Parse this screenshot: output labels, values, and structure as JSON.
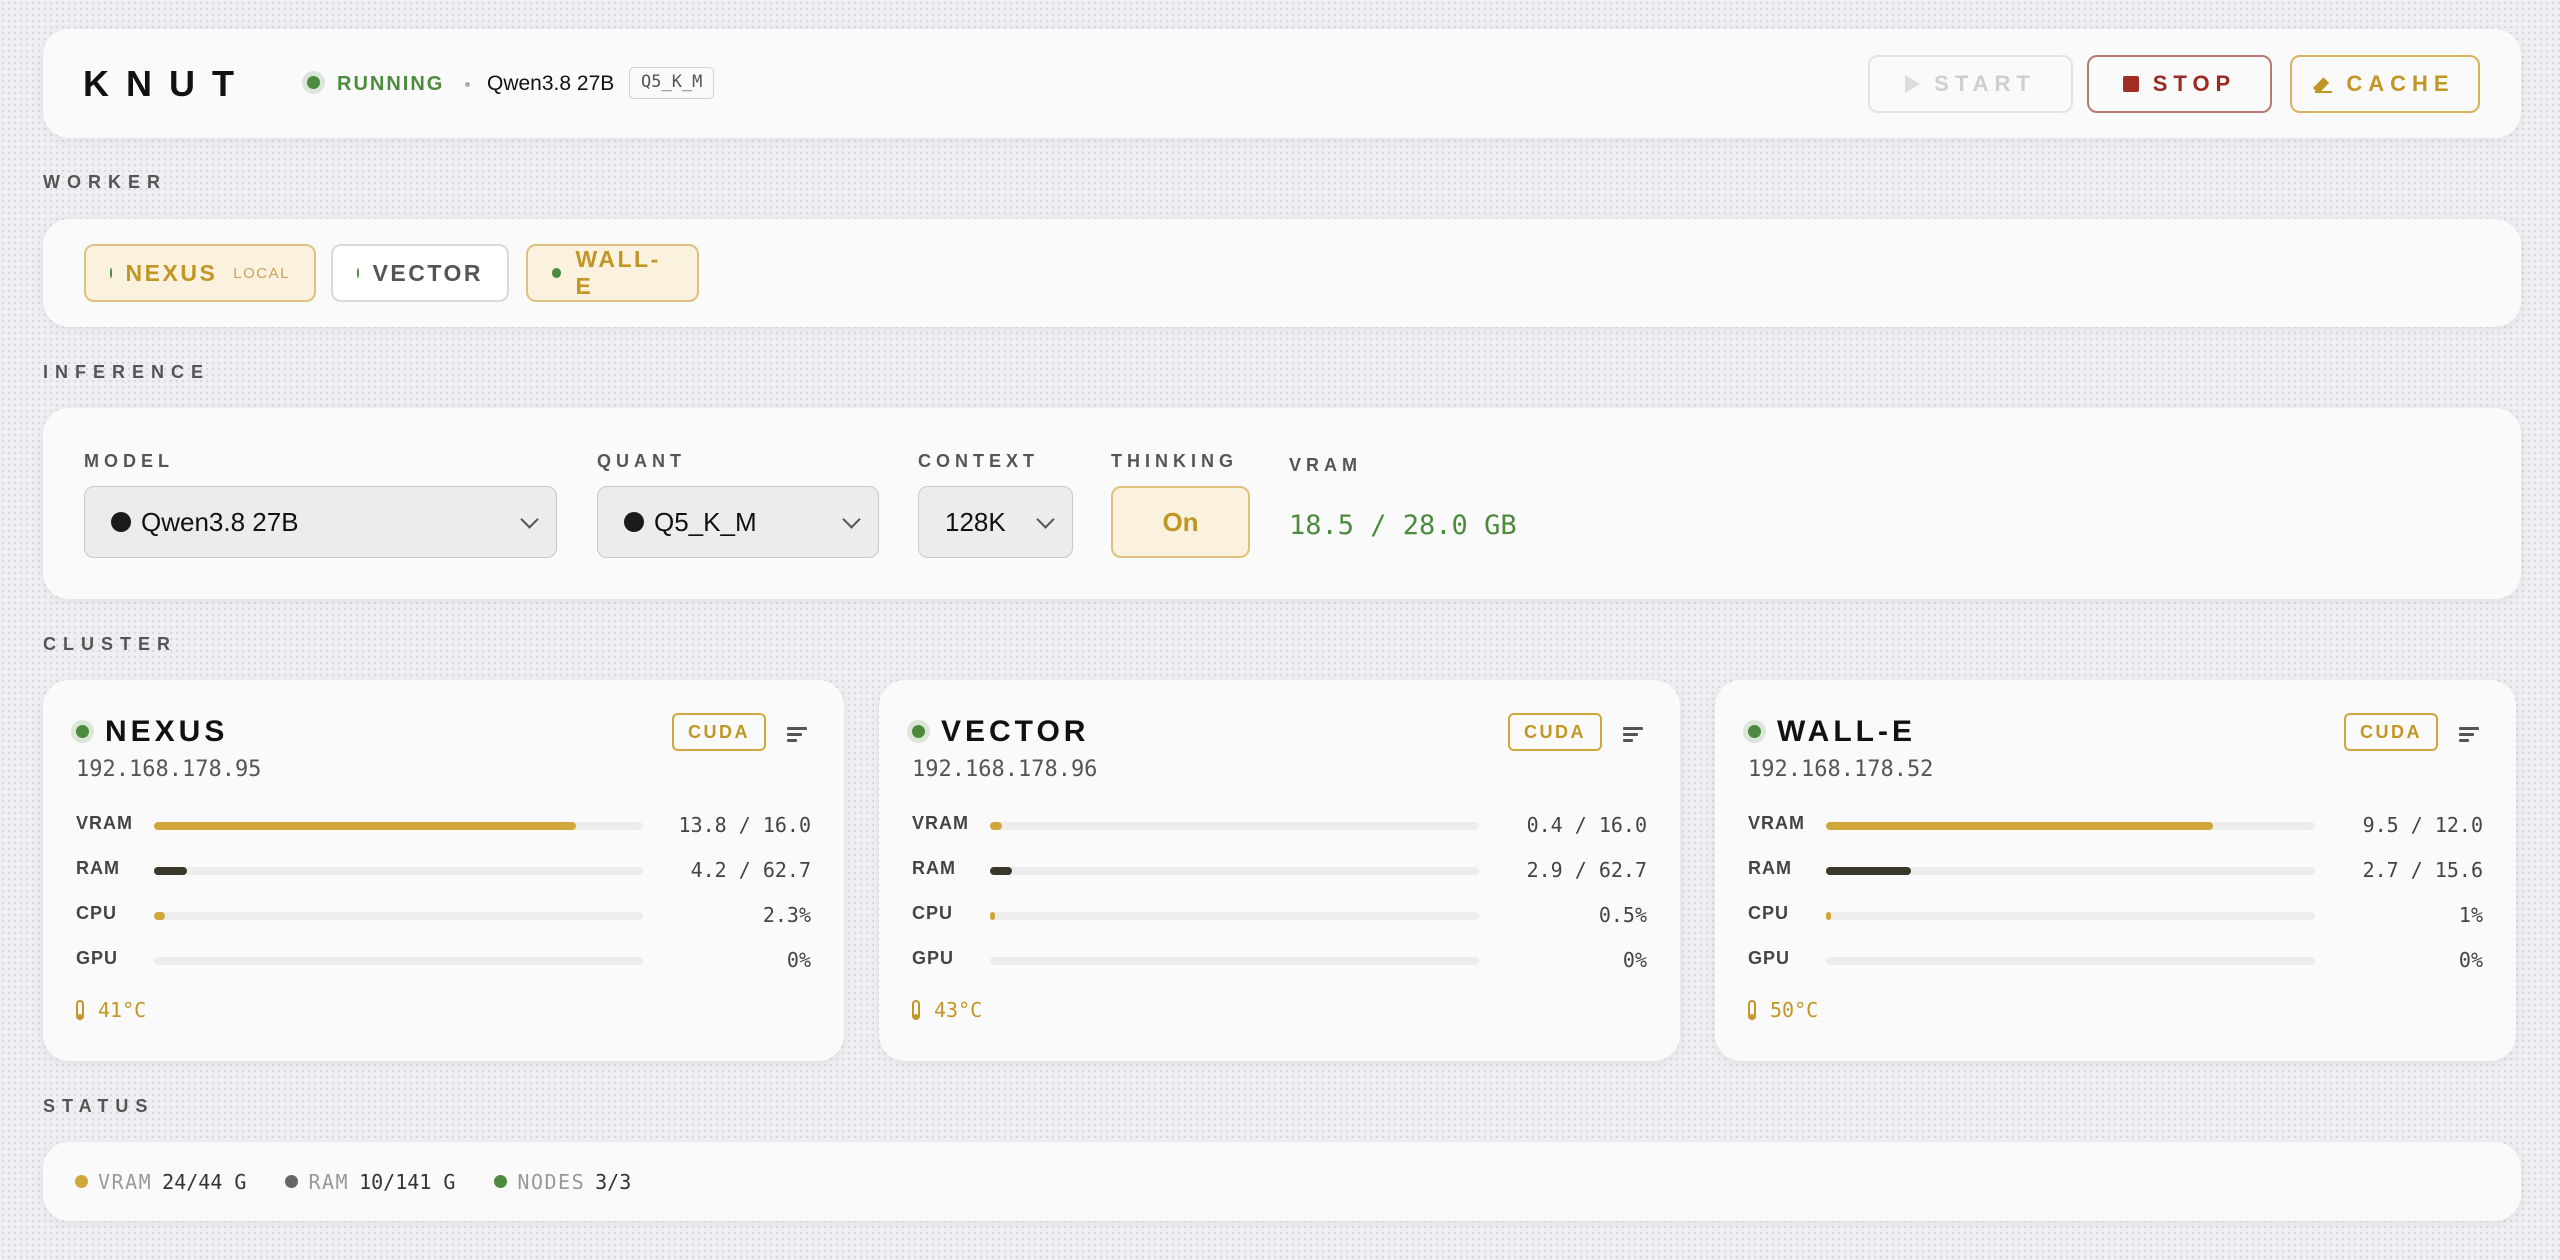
{
  "header": {
    "brand": "KNUT",
    "state": "RUNNING",
    "model": "Qwen3.8 27B",
    "quant": "Q5_K_M",
    "buttons": {
      "start": "START",
      "stop": "STOP",
      "cache": "CACHE"
    }
  },
  "sections": {
    "worker": "WORKER",
    "inference": "INFERENCE",
    "cluster": "CLUSTER",
    "status": "STATUS"
  },
  "workers": [
    {
      "name": "NEXUS",
      "tag": "LOCAL",
      "selected": true
    },
    {
      "name": "VECTOR",
      "tag": "",
      "selected": false
    },
    {
      "name": "WALL-E",
      "tag": "",
      "selected": true
    }
  ],
  "inference": {
    "model_label": "MODEL",
    "model_value": "Qwen3.8 27B",
    "quant_label": "QUANT",
    "quant_value": "Q5_K_M",
    "context_label": "CONTEXT",
    "context_value": "128K",
    "thinking_label": "THINKING",
    "thinking_value": "On",
    "vram_label": "VRAM",
    "vram_value": "18.5 / 28.0 GB"
  },
  "nodes": [
    {
      "name": "NEXUS",
      "ip": "192.168.178.95",
      "backend": "CUDA",
      "metrics": [
        {
          "label": "VRAM",
          "value": "13.8 / 16.0",
          "fraction": 0.8625
        },
        {
          "label": "RAM",
          "value": "4.2 / 62.7",
          "fraction": 0.067
        },
        {
          "label": "CPU",
          "value": "2.3%",
          "fraction": 0.023
        },
        {
          "label": "GPU",
          "value": "0%",
          "fraction": 0
        }
      ],
      "temp": "41°C"
    },
    {
      "name": "VECTOR",
      "ip": "192.168.178.96",
      "backend": "CUDA",
      "metrics": [
        {
          "label": "VRAM",
          "value": "0.4 / 16.0",
          "fraction": 0.025
        },
        {
          "label": "RAM",
          "value": "2.9 / 62.7",
          "fraction": 0.046
        },
        {
          "label": "CPU",
          "value": "0.5%",
          "fraction": 0.005
        },
        {
          "label": "GPU",
          "value": "0%",
          "fraction": 0
        }
      ],
      "temp": "43°C"
    },
    {
      "name": "WALL-E",
      "ip": "192.168.178.52",
      "backend": "CUDA",
      "metrics": [
        {
          "label": "VRAM",
          "value": "9.5 / 12.0",
          "fraction": 0.792
        },
        {
          "label": "RAM",
          "value": "2.7 / 15.6",
          "fraction": 0.173
        },
        {
          "label": "CPU",
          "value": "1%",
          "fraction": 0.01
        },
        {
          "label": "GPU",
          "value": "0%",
          "fraction": 0
        }
      ],
      "temp": "50°C"
    }
  ],
  "status": [
    {
      "label": "VRAM",
      "value": "24/44 G",
      "color": "#d1a73c"
    },
    {
      "label": "RAM",
      "value": "10/141 G",
      "color": "#666666"
    },
    {
      "label": "NODES",
      "value": "3/3",
      "color": "#4c8b3d"
    }
  ],
  "colors": {
    "accent": "#c19624",
    "running": "#4c8b3d",
    "stop": "#9a2a22",
    "vram_bar": "#d1a73c",
    "ram_bar": "#3a3728"
  }
}
